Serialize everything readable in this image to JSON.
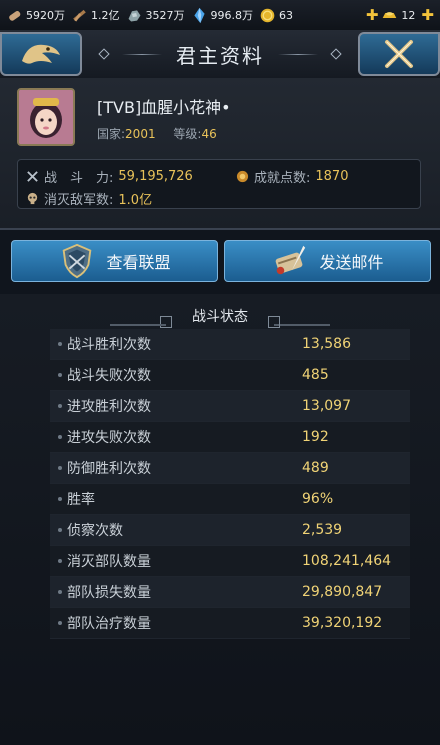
{
  "topbar": {
    "items": [
      {
        "icon": "bread-icon",
        "value": "5920万"
      },
      {
        "icon": "wood-icon",
        "value": "1.2亿"
      },
      {
        "icon": "iron-ore-icon",
        "value": "3527万"
      },
      {
        "icon": "crystal-icon",
        "value": "996.8万"
      },
      {
        "icon": "gold-coin-icon",
        "value": "63"
      },
      {
        "icon": "gold-ingot-icon",
        "value": "12"
      }
    ]
  },
  "header": {
    "title": "君主资料"
  },
  "profile": {
    "name": "[TVB]血腥小花神•",
    "country_label": "国家:",
    "country_value": "2001",
    "level_label": "等级:",
    "level_value": "46",
    "power_label": "战　斗　力:",
    "power_value": "59,195,726",
    "achievement_label": "成就点数:",
    "achievement_value": "1870",
    "kills_label": "消灭敌军数:",
    "kills_value": "1.0亿"
  },
  "buttons": {
    "view_alliance": "查看联盟",
    "send_mail": "发送邮件"
  },
  "battle": {
    "title": "战斗状态",
    "rows": [
      {
        "label": "战斗胜利次数",
        "value": "13,586"
      },
      {
        "label": "战斗失败次数",
        "value": "485"
      },
      {
        "label": "进攻胜利次数",
        "value": "13,097"
      },
      {
        "label": "进攻失败次数",
        "value": "192"
      },
      {
        "label": "防御胜利次数",
        "value": "489"
      },
      {
        "label": "胜率",
        "value": "96%"
      },
      {
        "label": "侦察次数",
        "value": "2,539"
      },
      {
        "label": "消灭部队数量",
        "value": "108,241,464"
      },
      {
        "label": "部队损失数量",
        "value": "29,890,847"
      },
      {
        "label": "部队治疗数量",
        "value": "39,320,192"
      }
    ]
  },
  "colors": {
    "accent_gold": "#e8c25a",
    "button_blue": "#2c7ab3"
  }
}
